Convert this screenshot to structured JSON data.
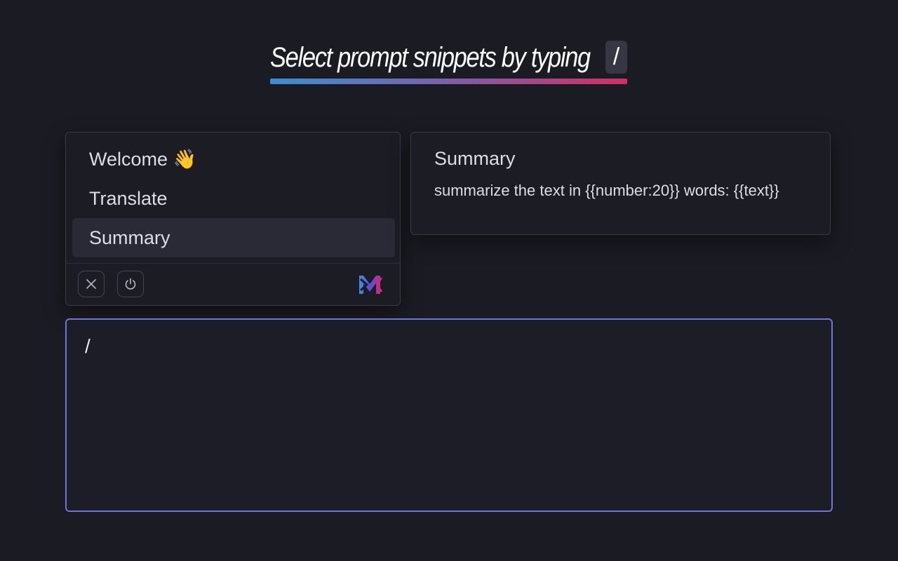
{
  "heading": {
    "text": "Select prompt snippets by typing",
    "key": "/",
    "gradient": [
      "#3c8fd0",
      "#7d5fa8",
      "#d02f63"
    ]
  },
  "menu": {
    "items": [
      {
        "label": "Welcome 👋",
        "active": false
      },
      {
        "label": "Translate",
        "active": false
      },
      {
        "label": "Summary",
        "active": true
      }
    ],
    "footer": {
      "close_icon": "close-icon",
      "power_icon": "power-icon",
      "logo_icon": "app-logo-icon"
    }
  },
  "preview": {
    "title": "Summary",
    "body": "summarize the text in {{number:20}} words: {{text}}"
  },
  "editor": {
    "value": "/",
    "focus_color": "#6f74d6"
  }
}
